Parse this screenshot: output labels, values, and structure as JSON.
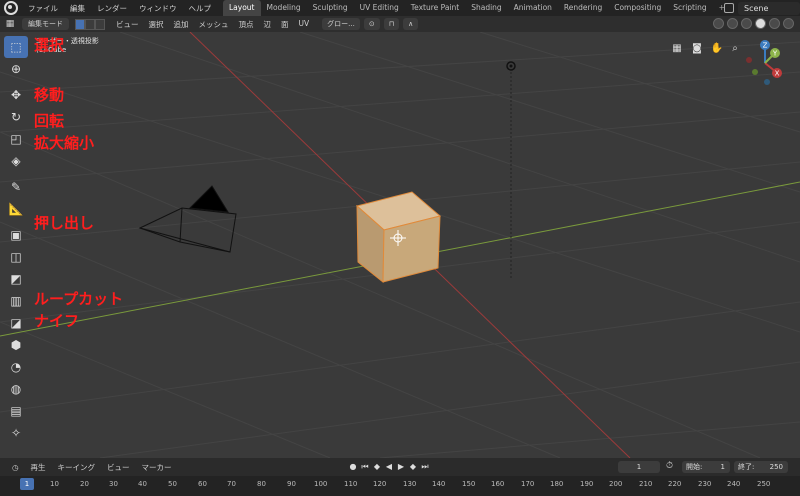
{
  "menu": [
    "ファイル",
    "編集",
    "レンダー",
    "ウィンドウ",
    "ヘルプ"
  ],
  "workspaces": [
    "Layout",
    "Modeling",
    "Sculpting",
    "UV Editing",
    "Texture Paint",
    "Shading",
    "Animation",
    "Rendering",
    "Compositing",
    "Scripting"
  ],
  "active_workspace": "Layout",
  "scene_name": "Scene",
  "viewport_header": {
    "mode": "編集モード",
    "menus": [
      "ビュー",
      "選択",
      "追加",
      "メッシュ",
      "頂点",
      "辺",
      "面",
      "UV"
    ],
    "transform_orientation": "グロー...",
    "icons": [
      "editor-type-icon",
      "vertex-select-icon",
      "edge-select-icon",
      "face-select-icon",
      "snap-icon",
      "proportional-edit-icon"
    ]
  },
  "overlay": {
    "view": "ユーザー・透視投影",
    "object": "(1) Cube"
  },
  "toolbar_icons": [
    "select-box-icon",
    "cursor-icon",
    "move-icon",
    "rotate-icon",
    "scale-icon",
    "transform-icon",
    "annotate-icon",
    "measure-icon",
    "extrude-icon",
    "inset-icon",
    "bevel-icon",
    "loop-cut-icon",
    "knife-icon",
    "poly-build-icon",
    "spin-icon",
    "smooth-icon",
    "edge-slide-icon",
    "shrink-fatten-icon",
    "shear-icon",
    "rip-icon"
  ],
  "annotations": [
    "選択",
    "移動",
    "回転",
    "拡大縮小",
    "押し出し",
    "ループカット",
    "ナイフ"
  ],
  "gizmo": {
    "x": "X",
    "y": "Y",
    "z": "Z"
  },
  "colors": {
    "accent": "#4772b3",
    "annotation": "#ff1e1e",
    "x_axis": "#c03b3b",
    "y_axis": "#8cb34a",
    "z_axis": "#3b7cc0",
    "cube": "#c8a87a"
  },
  "timeline": {
    "menus": [
      "再生",
      "キーイング",
      "ビュー",
      "マーカー"
    ],
    "current_frame": "1",
    "start_label": "開始:",
    "start": "1",
    "end_label": "終了:",
    "end": "250",
    "ticks": [
      "1",
      "10",
      "20",
      "30",
      "40",
      "50",
      "60",
      "70",
      "80",
      "90",
      "100",
      "110",
      "120",
      "130",
      "140",
      "150",
      "160",
      "170",
      "180",
      "190",
      "200",
      "210",
      "220",
      "230",
      "240",
      "250"
    ]
  }
}
